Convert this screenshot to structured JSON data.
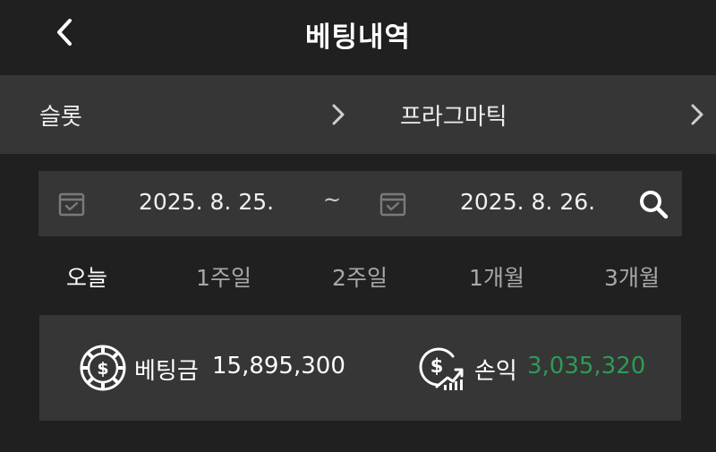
{
  "header": {
    "title": "베팅내역",
    "back_icon": "chevron-left-icon"
  },
  "categories": [
    {
      "label": "슬롯",
      "arrow_icon": "chevron-right-icon"
    },
    {
      "label": "프라그마틱",
      "arrow_icon": "chevron-right-icon"
    }
  ],
  "date_range": {
    "start": "2025. 8. 25.",
    "separator": "~",
    "end": "2025. 8. 26.",
    "calendar_icon": "calendar-icon",
    "search_icon": "search-icon"
  },
  "period_tabs": [
    {
      "label": "오늘",
      "active": true
    },
    {
      "label": "1주일",
      "active": false
    },
    {
      "label": "2주일",
      "active": false
    },
    {
      "label": "1개월",
      "active": false
    },
    {
      "label": "3개월",
      "active": false
    }
  ],
  "summary": {
    "bet": {
      "icon": "casino-chip-icon",
      "label": "베팅금",
      "value": "15,895,300"
    },
    "profit": {
      "icon": "dollar-growth-icon",
      "label": "손익",
      "value": "3,035,320",
      "value_color": "#2e9a55"
    }
  },
  "colors": {
    "background": "#202020",
    "panel": "#363636",
    "inactive_tab": "#a8a8a8",
    "profit_green": "#2e9a55"
  }
}
